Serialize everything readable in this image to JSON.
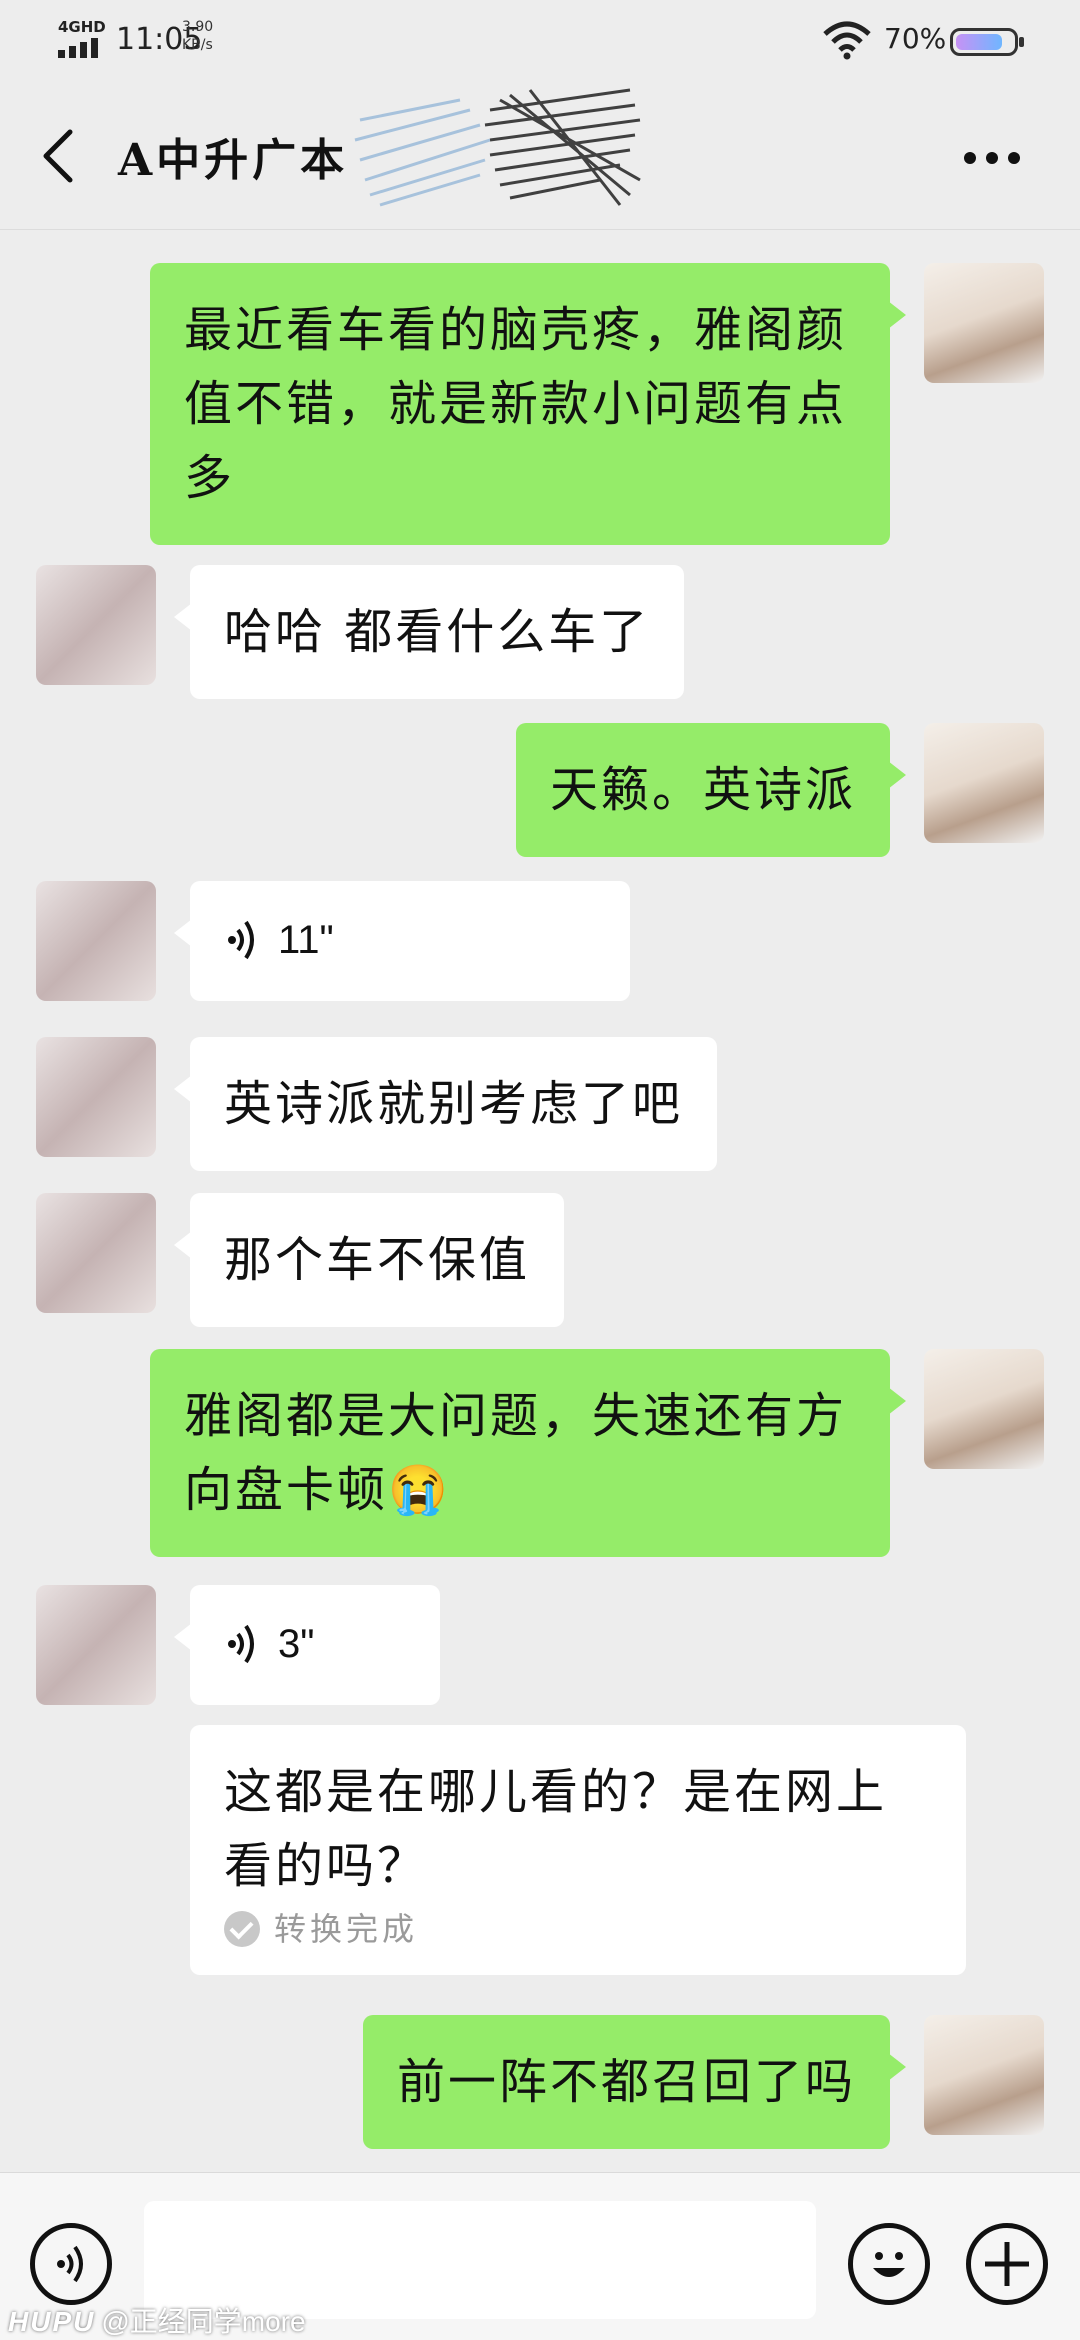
{
  "status_bar": {
    "network": "4GHD",
    "time": "11:05",
    "speed_value": "3.90",
    "speed_unit": "KB/s",
    "battery_percent": "70%"
  },
  "header": {
    "title": "A中升广本"
  },
  "messages": [
    {
      "direction": "out",
      "type": "text",
      "text": "最近看车看的脑壳疼，雅阁颜值不错，就是新款小问题有点多"
    },
    {
      "direction": "in",
      "type": "text",
      "text": "哈哈 都看什么车了"
    },
    {
      "direction": "out",
      "type": "text",
      "text": "天籁。英诗派"
    },
    {
      "direction": "in",
      "type": "voice",
      "duration": "11\""
    },
    {
      "direction": "in",
      "type": "text",
      "text": "英诗派就别考虑了吧"
    },
    {
      "direction": "in",
      "type": "text",
      "text": "那个车不保值"
    },
    {
      "direction": "out",
      "type": "text",
      "text": "雅阁都是大问题，失速还有方向盘卡顿😭"
    },
    {
      "direction": "in",
      "type": "voice",
      "duration": "3\""
    },
    {
      "direction": "in",
      "type": "transcript",
      "text": "这都是在哪儿看的？是在网上看的吗？",
      "status": "转换完成"
    },
    {
      "direction": "out",
      "type": "text",
      "text": "前一阵不都召回了吗"
    }
  ],
  "input_bar": {
    "text_value": ""
  },
  "watermark": {
    "brand": "HUPU",
    "handle": "@正经同学more"
  },
  "colors": {
    "outgoing_bubble": "#95ec69",
    "incoming_bubble": "#ffffff",
    "background": "#ededed"
  }
}
